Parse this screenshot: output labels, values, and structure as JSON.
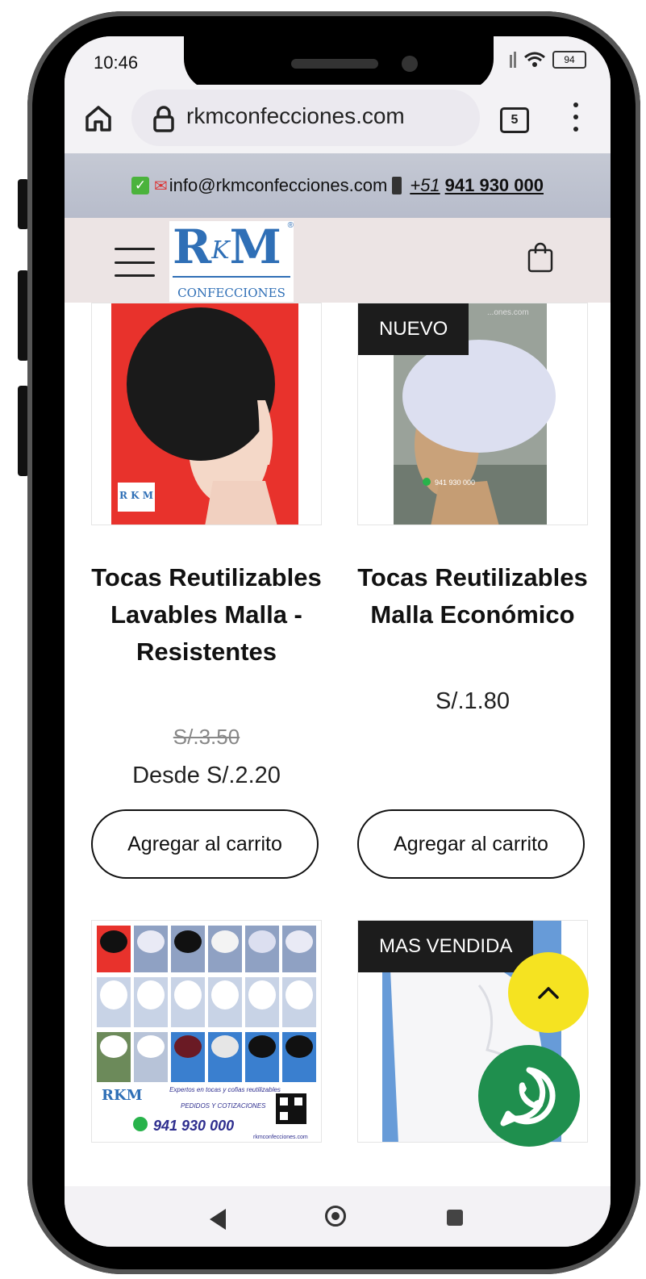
{
  "status": {
    "time": "10:46",
    "battery": "94"
  },
  "browser": {
    "url": "rkmconfecciones.com",
    "tab_count": "5"
  },
  "topbar": {
    "email": "info@rkmconfecciones.com",
    "phone_prefix": "+51",
    "phone_number": "941 930 000"
  },
  "header": {
    "logo_main_1": "R",
    "logo_main_k": "K",
    "logo_main_2": "M",
    "logo_sub": "CONFECCIONES",
    "logo_reg": "®"
  },
  "products": [
    {
      "title": "Tocas Reutilizables Lavables Malla - Resistentes",
      "old_price": "S/.3.50",
      "price": "Desde S/.2.20",
      "button": "Agregar al carrito",
      "badge": ""
    },
    {
      "title": "Tocas Reutilizables Malla Económico",
      "old_price": "",
      "price": "S/.1.80",
      "button": "Agregar al carrito",
      "badge": "NUEVO"
    },
    {
      "badge": ""
    },
    {
      "badge": "MAS VENDIDA"
    }
  ],
  "img_texts": {
    "p1_logo": "R K M",
    "p2_wa": "941 930 000",
    "p2_site": "...ones.com",
    "p3_caption": "Expertos en tocas y cofias reutilizables",
    "p3_orders": "PEDIDOS Y COTIZACIONES",
    "p3_phone": "941 930 000",
    "p3_site": "rkmconfecciones.com",
    "p3_brand": "RKM"
  },
  "colors": {
    "whatsapp": "#1f8f4e",
    "scroll_top": "#f5e321",
    "brand": "#2f6fb6",
    "badge_bg": "#1c1c1c"
  },
  "icons": [
    "home-icon",
    "lock-icon",
    "tabs-icon",
    "menu-icon",
    "check-icon",
    "envelope-icon",
    "phone-icon",
    "hamburger-icon",
    "shopping-bag-icon",
    "chevron-up-icon",
    "whatsapp-icon",
    "back-icon",
    "home-circle-icon",
    "recents-icon"
  ]
}
